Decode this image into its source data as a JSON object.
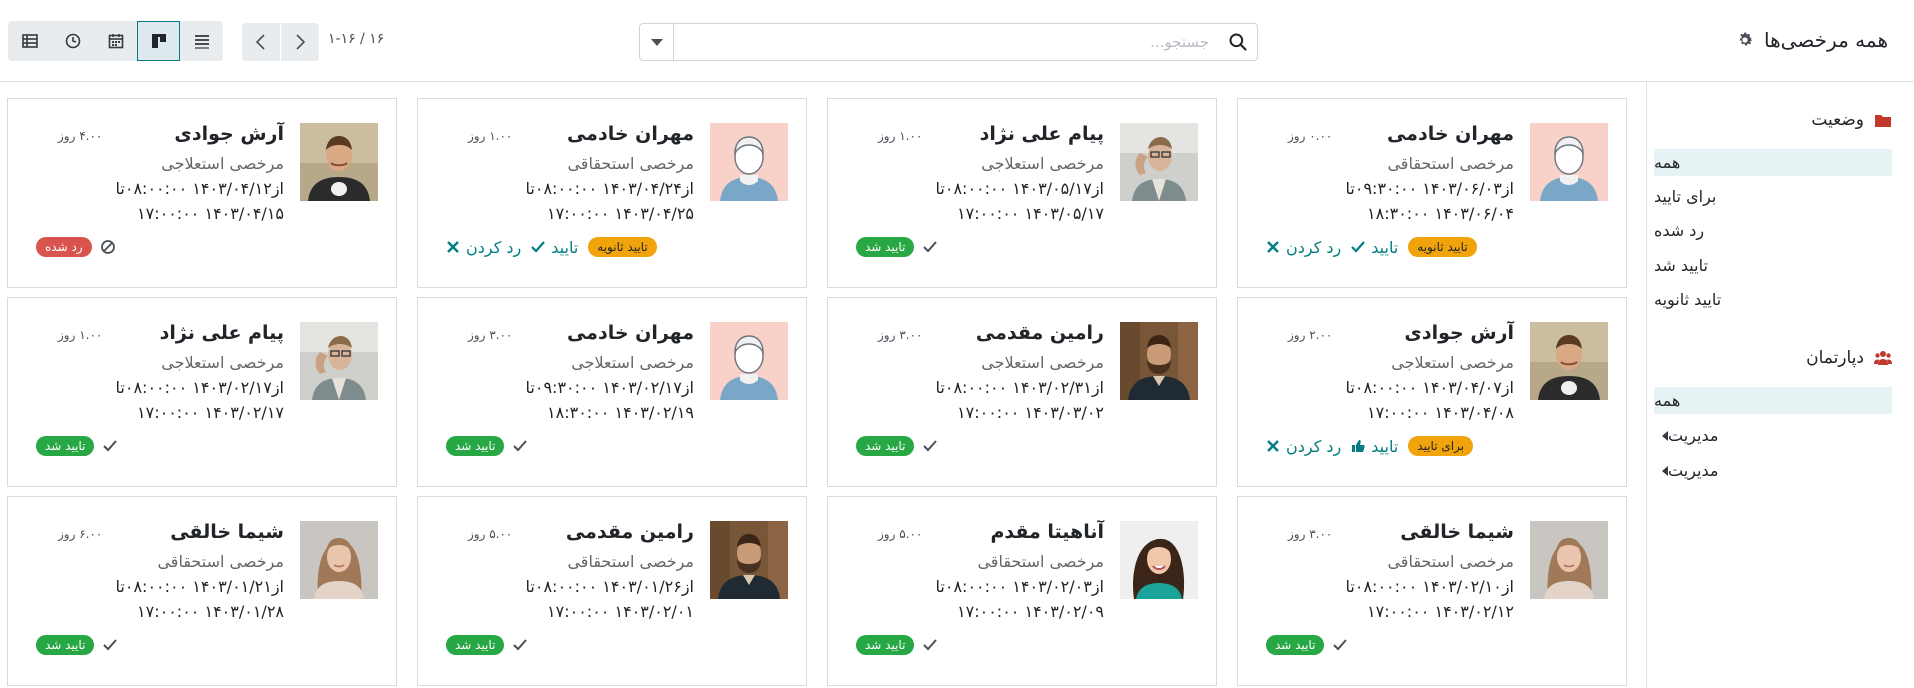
{
  "header": {
    "title": "همه مرخصی‌ها",
    "search_placeholder": "جستجو...",
    "pager": "۱-۱۶ / ۱۶"
  },
  "sidepanel": {
    "status": {
      "label": "وضعیت",
      "items": [
        "همه",
        "برای تایید",
        "رد شده",
        "تایید شد",
        "تایید ثانویه"
      ],
      "active": "همه"
    },
    "department": {
      "label": "دپارتمان",
      "items": [
        "همه",
        "مدیریت",
        "مدیریت"
      ],
      "active": "همه"
    }
  },
  "actions": {
    "approve": "تایید",
    "refuse": "رد کردن"
  },
  "cards": [
    {
      "name": "مهران خادمی",
      "days": "۰.۰۰ روز",
      "type": "مرخصی استحقاقی",
      "from": "از۱۴۰۳/۰۶/۰۳ ۰۹:۳۰:۰۰تا",
      "to": "۱۴۰۳/۰۶/۰۴ ۱۸:۳۰:۰۰",
      "status": "تایید ثانویه",
      "status_color": "#f0a30a",
      "avatar": "placeholder",
      "actions": true
    },
    {
      "name": "پیام علی نژاد",
      "days": "۱.۰۰ روز",
      "type": "مرخصی استعلاجی",
      "from": "از۱۴۰۳/۰۵/۱۷ ۰۸:۰۰:۰۰تا",
      "to": "۱۴۰۳/۰۵/۱۷ ۱۷:۰۰:۰۰",
      "status": "تایید شد",
      "status_color": "#28a745",
      "avatar": "payam",
      "actions": false
    },
    {
      "name": "مهران خادمی",
      "days": "۱.۰۰ روز",
      "type": "مرخصی استحقاقی",
      "from": "از۱۴۰۳/۰۴/۲۴ ۰۸:۰۰:۰۰تا",
      "to": "۱۴۰۳/۰۴/۲۵ ۱۷:۰۰:۰۰",
      "status": "تایید ثانویه",
      "status_color": "#f0a30a",
      "avatar": "placeholder",
      "actions": true
    },
    {
      "name": "آرش جوادی",
      "days": "۴.۰۰ روز",
      "type": "مرخصی استعلاجی",
      "from": "از۱۴۰۳/۰۴/۱۲ ۰۸:۰۰:۰۰تا",
      "to": "۱۴۰۳/۰۴/۱۵ ۱۷:۰۰:۰۰",
      "status": "رد شده",
      "status_color": "#d9534f",
      "avatar": "arash",
      "actions": false
    },
    {
      "name": "آرش جوادی",
      "days": "۲.۰۰ روز",
      "type": "مرخصی استعلاجی",
      "from": "از۱۴۰۳/۰۴/۰۷ ۰۸:۰۰:۰۰تا",
      "to": "۱۴۰۳/۰۴/۰۸ ۱۷:۰۰:۰۰",
      "status": "برای تایید",
      "status_color": "#f0a30a",
      "avatar": "arash",
      "actions": true
    },
    {
      "name": "رامین مقدمی",
      "days": "۳.۰۰ روز",
      "type": "مرخصی استعلاجی",
      "from": "از۱۴۰۳/۰۲/۳۱ ۰۸:۰۰:۰۰تا",
      "to": "۱۴۰۳/۰۳/۰۲ ۱۷:۰۰:۰۰",
      "status": "تایید شد",
      "status_color": "#28a745",
      "avatar": "ramin",
      "actions": false
    },
    {
      "name": "مهران خادمی",
      "days": "۳.۰۰ روز",
      "type": "مرخصی استعلاجی",
      "from": "از۱۴۰۳/۰۲/۱۷ ۰۹:۳۰:۰۰تا",
      "to": "۱۴۰۳/۰۲/۱۹ ۱۸:۳۰:۰۰",
      "status": "تایید شد",
      "status_color": "#28a745",
      "avatar": "placeholder",
      "actions": false
    },
    {
      "name": "پیام علی نژاد",
      "days": "۱.۰۰ روز",
      "type": "مرخصی استعلاجی",
      "from": "از۱۴۰۳/۰۲/۱۷ ۰۸:۰۰:۰۰تا",
      "to": "۱۴۰۳/۰۲/۱۷ ۱۷:۰۰:۰۰",
      "status": "تایید شد",
      "status_color": "#28a745",
      "avatar": "payam",
      "actions": false
    },
    {
      "name": "شیما خالقی",
      "days": "۳.۰۰ روز",
      "type": "مرخصی استحقاقی",
      "from": "از۱۴۰۳/۰۲/۱۰ ۰۸:۰۰:۰۰تا",
      "to": "۱۴۰۳/۰۲/۱۲ ۱۷:۰۰:۰۰",
      "status": "تایید شد",
      "status_color": "#28a745",
      "avatar": "shima",
      "actions": false
    },
    {
      "name": "آناهیتا مقدم",
      "days": "۵.۰۰ روز",
      "type": "مرخصی استحقاقی",
      "from": "از۱۴۰۳/۰۲/۰۳ ۰۸:۰۰:۰۰تا",
      "to": "۱۴۰۳/۰۲/۰۹ ۱۷:۰۰:۰۰",
      "status": "تایید شد",
      "status_color": "#28a745",
      "avatar": "anahita",
      "actions": false
    },
    {
      "name": "رامین مقدمی",
      "days": "۵.۰۰ روز",
      "type": "مرخصی استحقاقی",
      "from": "از۱۴۰۳/۰۱/۲۶ ۰۸:۰۰:۰۰تا",
      "to": "۱۴۰۳/۰۲/۰۱ ۱۷:۰۰:۰۰",
      "status": "تایید شد",
      "status_color": "#28a745",
      "avatar": "ramin",
      "actions": false
    },
    {
      "name": "شیما خالقی",
      "days": "۶.۰۰ روز",
      "type": "مرخصی استحقاقی",
      "from": "از۱۴۰۳/۰۱/۲۱ ۰۸:۰۰:۰۰تا",
      "to": "۱۴۰۳/۰۱/۲۸ ۱۷:۰۰:۰۰",
      "status": "تایید شد",
      "status_color": "#28a745",
      "avatar": "shima",
      "actions": false
    }
  ]
}
